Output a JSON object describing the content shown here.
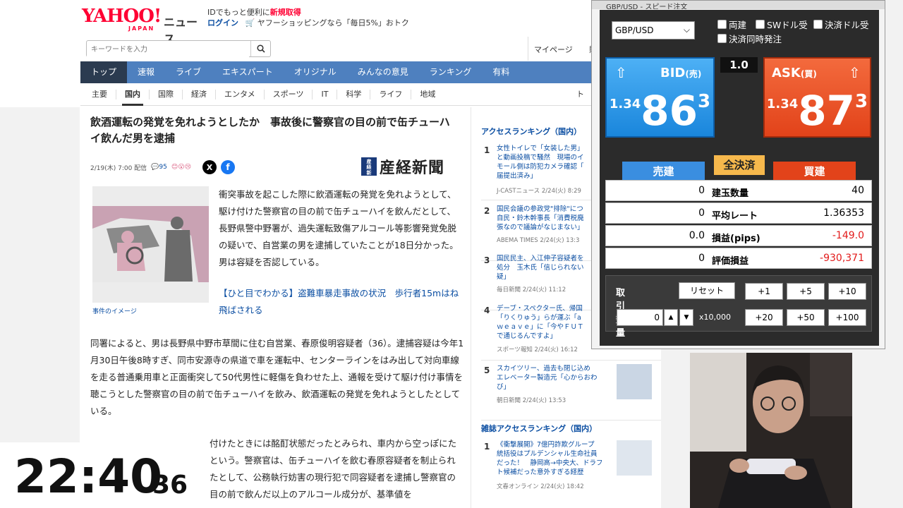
{
  "header": {
    "logo_main": "YAHOO!",
    "logo_sub": "JAPAN",
    "logo_news": "ニュース",
    "promo_line1_prefix": "IDでもっと便利に",
    "promo_line1_link": "新規取得",
    "login": "ログイン",
    "promo_line2": "ヤフーショッピングなら「毎日5%」おトク",
    "search_placeholder": "キーワードを入力",
    "mypage": "マイページ",
    "mypage_tail": "購"
  },
  "global_nav": [
    "トップ",
    "速報",
    "ライブ",
    "エキスパート",
    "オリジナル",
    "みんなの意見",
    "ランキング",
    "有料"
  ],
  "category_nav": [
    "主要",
    "国内",
    "国際",
    "経済",
    "エンタメ",
    "スポーツ",
    "IT",
    "科学",
    "ライフ",
    "地域"
  ],
  "category_nav_tail": "ト",
  "article": {
    "title": "飲酒運転の発覚を免れようとしたか　事故後に警察官の目の前で缶チューハイ飲んだ男を逮捕",
    "date": "2/19(木) 7:00 配信",
    "comments": "95",
    "source_mark": "産経新聞",
    "source": "産経新聞",
    "image_caption": "事件のイメージ",
    "lead": "衝突事故を起こした際に飲酒運転の発覚を免れようとして、駆け付けた警察官の目の前で缶チューハイを飲んだとして、長野県警中野署が、過失運転致傷アルコール等影響発覚免脱の疑いで、自営業の男を逮捕していたことが18日分かった。男は容疑を否認している。",
    "related_link": "【ひと目でわかる】盗難車暴走事故の状況　歩行者15mはね飛ばされる",
    "body1": "同署によると、男は長野県中野市草間に住む自営業、春原俊明容疑者（36）。逮捕容疑は今年1月30日午後8時すぎ、同市安源寺の県道で車を運転中、センターラインをはみ出して対向車線を走る普通乗用車と正面衝突して50代男性に軽傷を負わせた上、通報を受けて駆け付け事情を聴こうとした警察官の目の前で缶チューハイを飲み、飲酒運転の発覚を免れようとしたとしている。",
    "body2": "付けたときには酩酊状態だったとみられ、車内から空っぽにたという。警察官は、缶チューハイを飲む春原容疑者を制止られたとして、公務執行妨害の現行犯で同容疑者を逮捕し警察官の目の前で飲んだ以上のアルコール成分が、基準値を"
  },
  "ranking": {
    "heading": "アクセスランキング（国内）",
    "items": [
      {
        "no": "1",
        "title": "女性トイレで「女装した男」\nと動画投稿で騒然　現場のイ\nモール側は防犯カメラ確認「\n届提出済み」",
        "source": "J-CASTニュース 2/24(火) 8:29"
      },
      {
        "no": "2",
        "title": "国民会議の参政党\"排除\"につ\n自民・鈴木幹事長「消費税廃\n張なので議論がなじまない」",
        "source": "ABEMA TIMES 2/24(火) 13:3"
      },
      {
        "no": "3",
        "title": "国民民主、入江伸子容疑者を\n処分　玉木氏「信じられない\n疑」",
        "source": "毎日新聞 2/24(火) 11:12"
      },
      {
        "no": "4",
        "title": "デーブ・スペクター氏、帰国\n「りくりゅう」らが運ぶ「a\nｗｅａｖｅ」に「今やＦＵＴ\nで通じるんですよ」",
        "source": "スポーツ報知 2/24(火) 16:12"
      },
      {
        "no": "5",
        "title": "スカイツリー、過去も閉じ込め\nエレベーター製造元「心からおわ\nび」",
        "source": "朝日新聞 2/24(火) 13:53"
      }
    ],
    "heading2": "雑誌アクセスランキング（国内）",
    "items2": [
      {
        "no": "1",
        "title": "《衝撃展開》7億円詐欺グループ\n統括役はプルデンシャル生命社員\nだった！　静岡高→中央大、ドラフ\nト候補だった意外すぎる経歴",
        "source": "文春オンライン 2/24(火) 18:42"
      }
    ]
  },
  "clock": {
    "hm": "22:40",
    "sec": "36"
  },
  "fx": {
    "title": "GBP/USD - スピード注文",
    "pair": "GBP/USD",
    "options": [
      "両建",
      "SWドル受",
      "決済ドル受",
      "決済同時発注"
    ],
    "bid_label": "BID",
    "bid_sub": "(売)",
    "ask_label": "ASK",
    "ask_sub": "(買)",
    "bid_price": {
      "head": "1.34",
      "main": "86",
      "tail": "3"
    },
    "ask_price": {
      "head": "1.34",
      "main": "87",
      "tail": "3"
    },
    "spread": "1.0",
    "sell_btn": "売建",
    "close_all_btn": "全決済",
    "buy_btn": "買建",
    "rows": [
      {
        "sell": "0",
        "label": "建玉数量",
        "buy": "40"
      },
      {
        "sell": "0",
        "label": "平均レート",
        "buy": "1.36353"
      },
      {
        "sell": "0.0",
        "label": "損益(pips)",
        "buy": "-149.0"
      },
      {
        "sell": "0",
        "label": "評価損益",
        "buy": "-930,371"
      }
    ],
    "qty_label": "取引数量",
    "reset": "リセット",
    "qty_buttons": [
      "+1",
      "+5",
      "+10",
      "+20",
      "+50",
      "+100"
    ],
    "qty_value": "0",
    "multiplier": "x10,000"
  },
  "colors": {
    "yahoo_red": "#ff0033",
    "nav_blue": "#4e80bf",
    "bid_blue": "#1a86dc",
    "ask_red": "#e2431a",
    "loss_red": "#e21b1b"
  }
}
